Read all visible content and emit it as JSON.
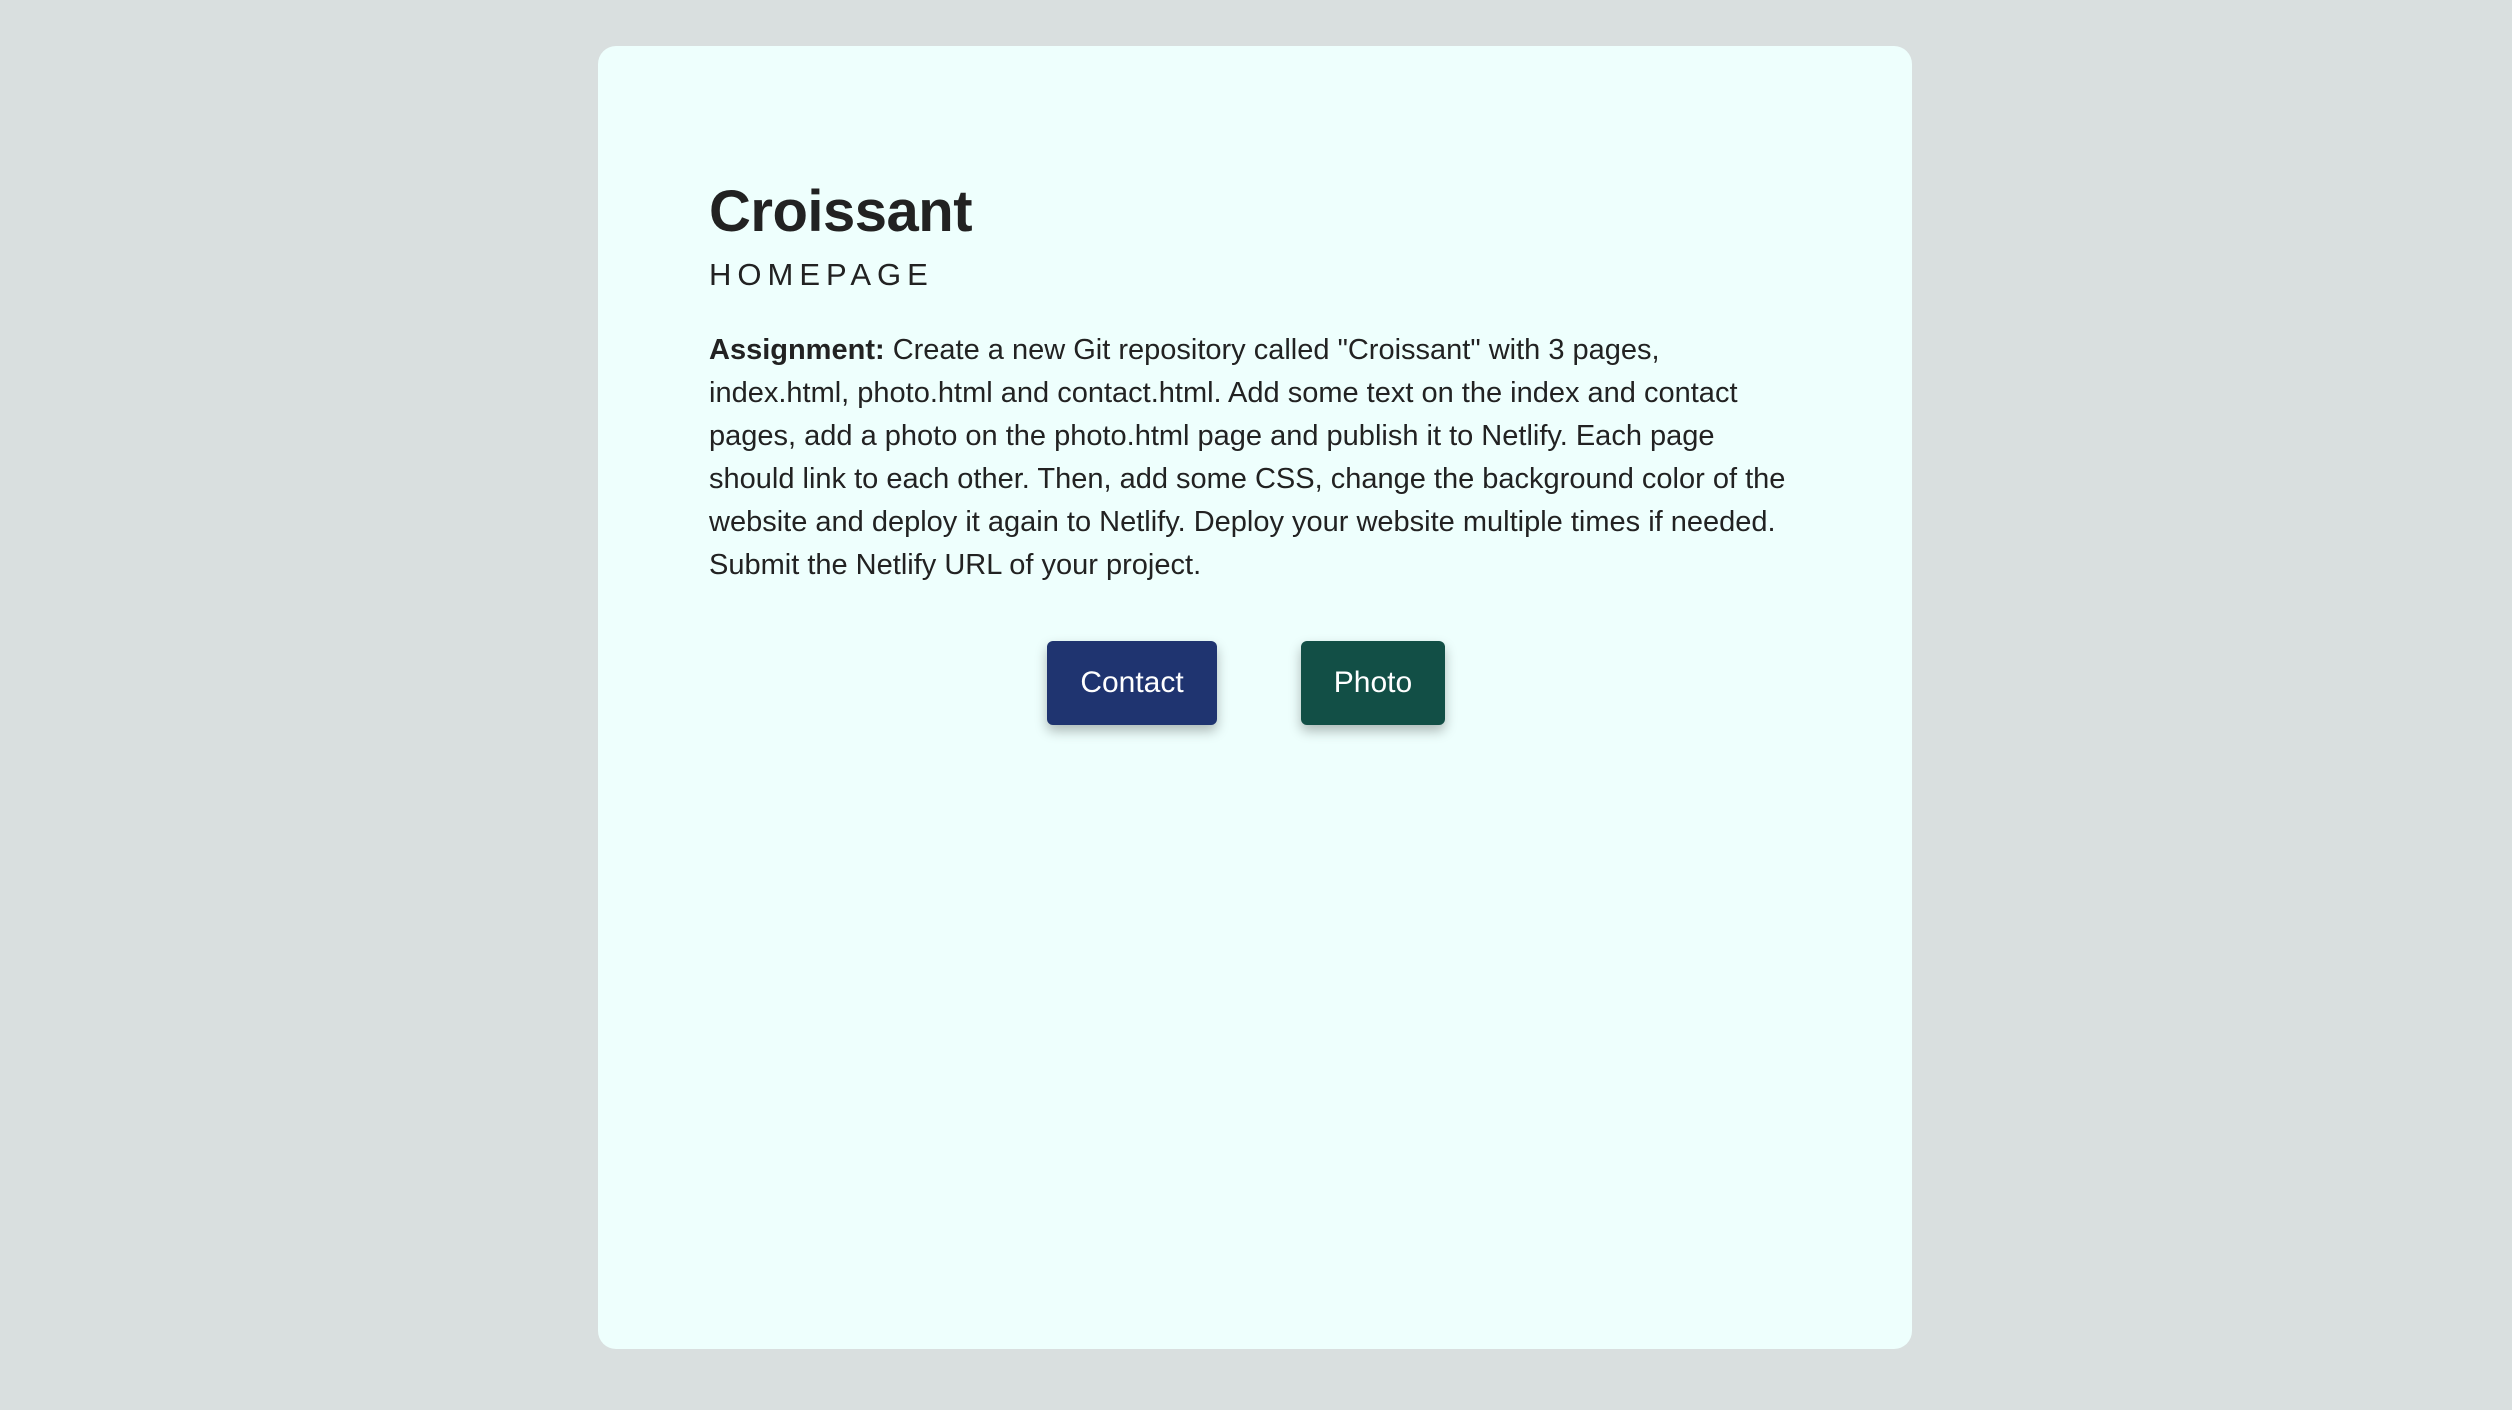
{
  "page": {
    "title": "Croissant",
    "subtitle": "HOMEPAGE"
  },
  "assignment": {
    "label": "Assignment:",
    "text": " Create a new Git repository called \"Croissant\" with 3 pages, index.html, photo.html and contact.html. Add some text on the index and contact pages, add a photo on the photo.html page and publish it to Netlify. Each page should link to each other. Then, add some CSS, change the background color of the website and deploy it again to Netlify. Deploy your website multiple times if needed. Submit the Netlify URL of your project."
  },
  "buttons": {
    "contact_label": "Contact",
    "photo_label": "Photo"
  },
  "colors": {
    "background": "#d9dfdf",
    "card": "#eefffd",
    "contact_button": "#1f3470",
    "photo_button": "#124f46"
  }
}
